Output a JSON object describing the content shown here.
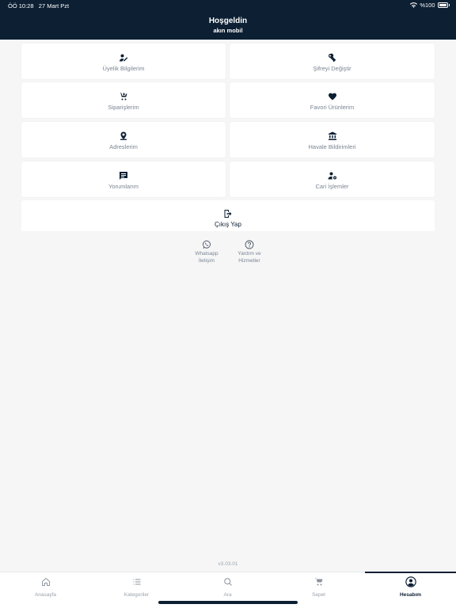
{
  "status_bar": {
    "time": "ÖÖ 10:28",
    "date": "27 Mart Pzt",
    "battery": "%100"
  },
  "header": {
    "greeting": "Hoşgeldin",
    "username": "akın mobil"
  },
  "menu": {
    "uyelik": "Üyelik Bilgilerim",
    "sifre": "Şifreyi Değiştir",
    "siparis": "Siparişlerim",
    "favori": "Favori Ürünlerim",
    "adres": "Adreslerim",
    "havale": "Havale Bildirimleri",
    "yorum": "Yorumlarım",
    "cari": "Cari İşlemler"
  },
  "logout": {
    "label": "Çıkış Yap"
  },
  "help": {
    "whatsapp_line1": "Whatsapp",
    "whatsapp_line2": "İletişim",
    "yardim_line1": "Yardım ve",
    "yardim_line2": "Hizmetler"
  },
  "version": "v3.03.01",
  "tabs": {
    "home": "Anasayfa",
    "categories": "Kategoriler",
    "search": "Ara",
    "cart": "Sepet",
    "account": "Hesabım"
  },
  "colors": {
    "primary": "#0c1f33",
    "muted": "#7a8593",
    "background": "#f6f6f7"
  }
}
